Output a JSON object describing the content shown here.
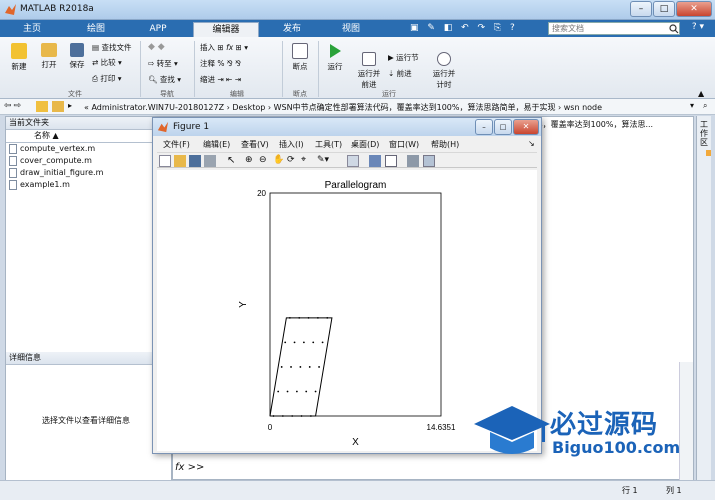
{
  "window": {
    "title": "MATLAB R2018a"
  },
  "tabs": [
    {
      "label": "主页"
    },
    {
      "label": "绘图"
    },
    {
      "label": "APP"
    },
    {
      "label": "编辑器"
    },
    {
      "label": "发布"
    },
    {
      "label": "视图"
    }
  ],
  "search": {
    "placeholder": "搜索文档"
  },
  "ribbon": {
    "new": "新建",
    "open": "打开",
    "save": "保存",
    "find_file": "查找文件",
    "compare": "比较",
    "print": "打印",
    "goto": "转至",
    "find": "查找",
    "insert": "插入",
    "comment": "注释",
    "indent": "缩进",
    "fx": "fx",
    "breakpoint": "断点",
    "run": "运行",
    "run_advance": "运行并\n前进",
    "run_section": "运行节",
    "advance": "前进",
    "run_time": "运行并\n计时",
    "groups": {
      "file": "文件",
      "nav": "导航",
      "edit": "编辑",
      "bp": "断点",
      "run": "运行"
    }
  },
  "address": {
    "path": "« Administrator.WIN7U-20180127Z › Desktop › WSN中节点确定性部署算法代码，覆盖率达到100%，算法思路简单，易于实现 › wsn node",
    "right_fragment": "%，覆盖率达到100%，算法思..."
  },
  "left_panel": {
    "title": "当前文件夹",
    "col_header": "名称 ▲",
    "files": [
      {
        "name": "compute_vertex.m"
      },
      {
        "name": "cover_compute.m"
      },
      {
        "name": "draw_initial_figure.m"
      },
      {
        "name": "example1.m"
      }
    ],
    "details_title": "详细信息",
    "details_hint": "选择文件以查看详细信息"
  },
  "right_strip": {
    "label": "工作区"
  },
  "figure": {
    "title": "Figure 1",
    "menu": [
      {
        "label": "文件(F)"
      },
      {
        "label": "编辑(E)"
      },
      {
        "label": "查看(V)"
      },
      {
        "label": "插入(I)"
      },
      {
        "label": "工具(T)"
      },
      {
        "label": "桌面(D)"
      },
      {
        "label": "窗口(W)"
      },
      {
        "label": "帮助(H)"
      }
    ]
  },
  "chart_data": {
    "type": "line",
    "title": "Parallelogram",
    "xlabel": "X",
    "ylabel": "Y",
    "xlim": [
      0,
      14.6351
    ],
    "ylim": [
      0,
      20
    ],
    "x_ticks": [
      "0",
      "14.6351"
    ],
    "y_ticks": [
      "20"
    ],
    "polygon": [
      [
        0,
        0
      ],
      [
        3.9,
        0
      ],
      [
        5.3,
        8.8
      ],
      [
        1.4,
        8.8
      ],
      [
        0,
        0
      ]
    ],
    "points": [
      [
        0.3,
        0
      ],
      [
        1.1,
        0
      ],
      [
        1.9,
        0
      ],
      [
        2.7,
        0
      ],
      [
        3.5,
        0
      ],
      [
        0.7,
        2.2
      ],
      [
        1.5,
        2.2
      ],
      [
        2.3,
        2.2
      ],
      [
        3.1,
        2.2
      ],
      [
        3.9,
        2.2
      ],
      [
        1.0,
        4.4
      ],
      [
        1.8,
        4.4
      ],
      [
        2.6,
        4.4
      ],
      [
        3.4,
        4.4
      ],
      [
        4.2,
        4.4
      ],
      [
        1.3,
        6.6
      ],
      [
        2.1,
        6.6
      ],
      [
        2.9,
        6.6
      ],
      [
        3.7,
        6.6
      ],
      [
        4.5,
        6.6
      ],
      [
        1.7,
        8.8
      ],
      [
        2.5,
        8.8
      ],
      [
        3.3,
        8.8
      ],
      [
        4.1,
        8.8
      ],
      [
        4.9,
        8.8
      ]
    ],
    "grid": false,
    "colors": {
      "line": "#000000"
    }
  },
  "command": {
    "prompt": "fx >>"
  },
  "status": {
    "line_label": "行",
    "line_val": "1",
    "col_label": "列",
    "col_val": "1"
  },
  "watermark": {
    "cn": "必过源码",
    "en": "Biguo100.com"
  }
}
